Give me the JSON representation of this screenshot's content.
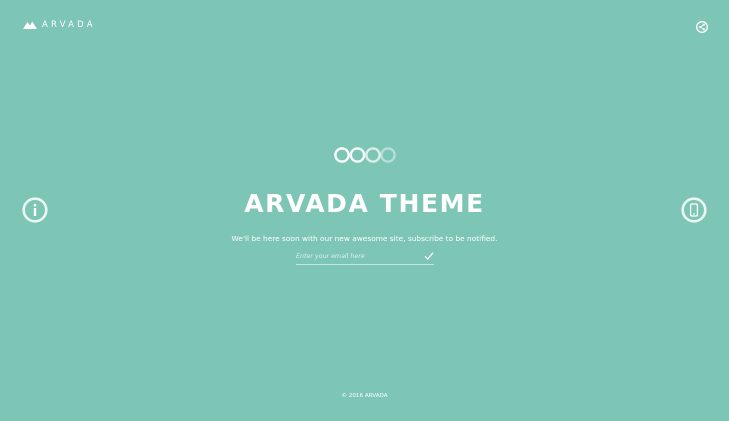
{
  "colors": {
    "background": "#7dc5b4",
    "foreground": "#ffffff"
  },
  "header": {
    "logo_text": "ARVADA",
    "logo_icon": "mountain-icon",
    "share_icon": "share-icon"
  },
  "main": {
    "progress_icons": "loading-circles-icon",
    "title": "ARVADA THEME",
    "subtitle": "We'll be here soon with our new awesome site, subscribe to be notified.",
    "email_placeholder": "Enter your email here",
    "submit_icon": "checkmark-icon"
  },
  "side": {
    "left_icon": "info-icon",
    "right_icon": "mobile-phone-icon"
  },
  "footer": {
    "copyright": "© 2016 ARVADA"
  }
}
